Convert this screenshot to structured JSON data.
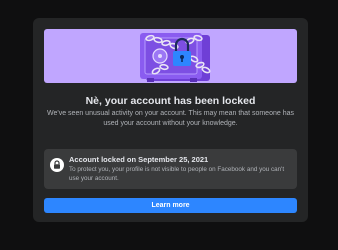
{
  "dialog": {
    "title": "Nè, your account has been locked",
    "description": "We've seen unusual activity on your account. This may mean that someone has used your account without your knowledge.",
    "notice": {
      "icon": "lock-icon",
      "title": "Account locked on September 25, 2021",
      "body": "To protect you, your profile is not visible to people on Facebook and you can't use your account."
    },
    "learn_more_label": "Learn more"
  },
  "colors": {
    "background": "#0f0f10",
    "card": "#242526",
    "banner": "#c0a6ff",
    "safe": "#7b4ae0",
    "notice_bg": "#3a3b3c",
    "button": "#2d86ff"
  }
}
